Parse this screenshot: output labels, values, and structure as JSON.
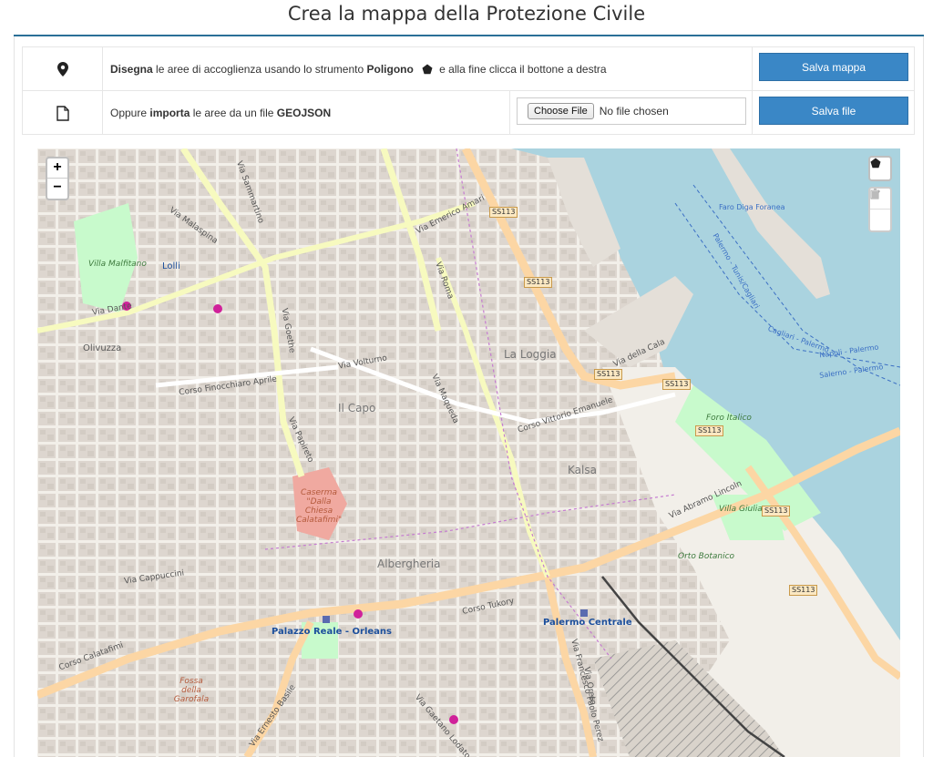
{
  "page": {
    "title": "Crea la mappa della Protezione Civile"
  },
  "toolbar": {
    "row1": {
      "icon": "map-marker-icon",
      "strong1": "Disegna",
      "text1": " le aree di accoglienza usando lo strumento ",
      "strong2": "Poligono",
      "polygon_icon": "pentagon-icon",
      "text2": " e alla fine clicca il bottone a destra",
      "button": "Salva mappa"
    },
    "row2": {
      "icon": "file-icon",
      "text1": "Oppure ",
      "strong1": "importa",
      "text2": " le aree da un file ",
      "strong2": "GEOJSON",
      "file_button": "Choose File",
      "file_status": "No file chosen",
      "button": "Salva file"
    }
  },
  "map": {
    "zoom_in": "+",
    "zoom_out": "−",
    "draw_polygon_icon": "pentagon-icon",
    "edit_icon": "edit-icon",
    "delete_icon": "trash-icon",
    "colors": {
      "land": "#f2efe9",
      "sea": "#aad3df",
      "primary_road": "#fcd6a4",
      "secondary_road": "#f7fabf",
      "park": "#c8facc"
    },
    "place_labels": [
      "La Loggia",
      "Il Capo",
      "Kalsa",
      "Albergheria",
      "Olivuzza",
      "Foro Italico",
      "Villa Giulia",
      "Orto Botanico",
      "Villa Malfitano"
    ],
    "station_labels": [
      "Palazzo Reale - Orleans",
      "Palermo Centrale",
      "Lolli"
    ],
    "poi_labels": [
      "Caserma \"Dalla Chiesa Calatafimi\"",
      "Fossa della Garofala",
      "Faro Diga Foranea"
    ],
    "road_labels": [
      "Via Emerico Amari",
      "Via Roma",
      "Via Goethe",
      "Via Papireto",
      "Corso Vittorio Emanuele",
      "Via Abramo Lincoln",
      "Corso Tukory",
      "Corso Calatafimi",
      "Via Maqueda",
      "Via della Cala",
      "Via Cappuccini",
      "Via Dante",
      "Corso Finocchiaro Aprile",
      "Via Sammartino",
      "Via Francesco Paolo Perez",
      "Via Oreto",
      "Via Ernesto Basile",
      "Via Gaetano Lodato",
      "Via Malaspina",
      "Via Volturno"
    ],
    "shields": [
      "SS113",
      "SS113",
      "SS113",
      "SS113",
      "SS113",
      "SS113",
      "SS113"
    ],
    "sea_labels": [
      "Cagliari - Palermo",
      "Napoli - Palermo",
      "Salerno - Palermo",
      "Palermo - Tunis/Cagliari"
    ]
  }
}
